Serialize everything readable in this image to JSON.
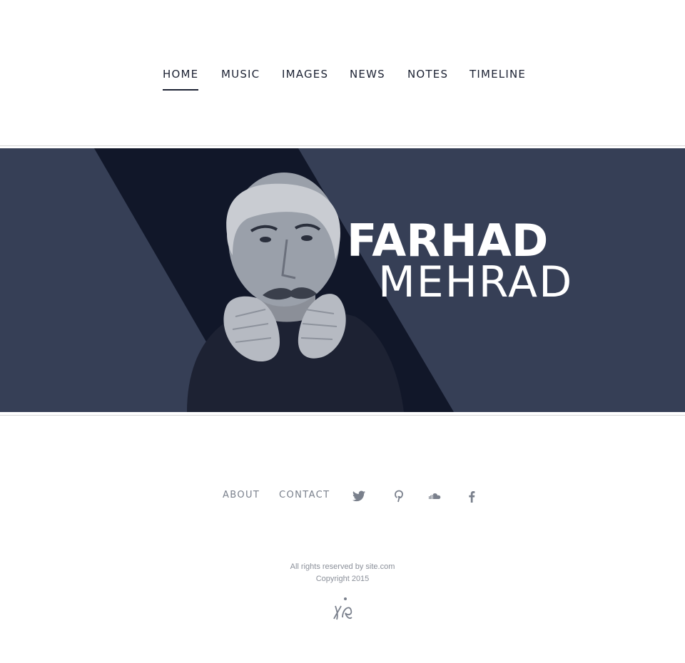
{
  "nav": {
    "items": [
      {
        "label": "HOME",
        "active": true
      },
      {
        "label": "MUSIC",
        "active": false
      },
      {
        "label": "IMAGES",
        "active": false
      },
      {
        "label": "NEWS",
        "active": false
      },
      {
        "label": "NOTES",
        "active": false
      },
      {
        "label": "TIMELINE",
        "active": false
      }
    ]
  },
  "hero": {
    "first_name": "FARHAD",
    "last_name": "MEHRAD",
    "colors": {
      "background": "#363f56",
      "stripe": "#111729",
      "text": "#ffffff"
    }
  },
  "footer": {
    "links": [
      {
        "label": "ABOUT"
      },
      {
        "label": "CONTACT"
      }
    ],
    "social": [
      "twitter-icon",
      "pinterest-icon",
      "soundcloud-icon",
      "facebook-icon"
    ],
    "rights": "All rights reserved by site.com",
    "copyright": "Copyright 2015",
    "logo": "site-logo-icon"
  },
  "colors": {
    "nav_text": "#1c2233",
    "footer_text": "#7a808c"
  }
}
